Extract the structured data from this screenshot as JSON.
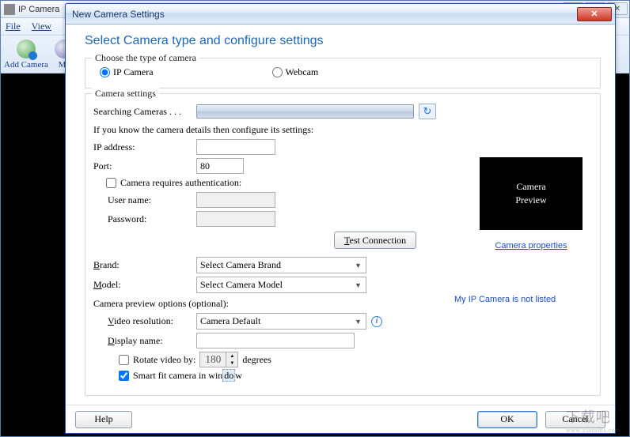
{
  "main": {
    "title": "IP Camera",
    "menu": {
      "file": "File",
      "view": "View"
    },
    "toolbar": {
      "addCamera": "Add Camera",
      "manage": "Ma"
    },
    "winbtn": {
      "min": "—",
      "max": "□",
      "close": "✕"
    }
  },
  "dialog": {
    "title": "New Camera Settings",
    "close_glyph": "✕",
    "heading": "Select Camera type and configure settings",
    "group_type_legend": "Choose the type of camera",
    "radio_ip": "IP Camera",
    "radio_webcam": "Webcam",
    "group_settings_legend": "Camera settings",
    "searching_label": "Searching Cameras . . .",
    "refresh_glyph": "↻",
    "know_details": "If you know the camera details then configure its settings:",
    "ip_label": "IP address:",
    "ip_value": "",
    "port_label": "Port:",
    "port_value": "80",
    "auth_label": "Camera requires authentication:",
    "user_label": "User name:",
    "user_value": "",
    "pass_label": "Password:",
    "pass_value": "",
    "test_btn": "Test Connection",
    "brand_label": "Brand:",
    "brand_value": "Select Camera Brand",
    "model_label": "Model:",
    "model_value": "Select Camera Model",
    "preview_opts": "Camera preview options (optional):",
    "vres_label": "Video resolution:",
    "vres_value": "Camera Default",
    "dname_label": "Display name:",
    "dname_value": "",
    "rotate_label_pre": "Rotate video by:",
    "rotate_value": "180",
    "rotate_label_post": "degrees",
    "smartfit_label_pre": "Smart fit camera in win",
    "smartfit_label_post": "w",
    "preview_text": "Camera\nPreview",
    "cam_props_link": "Camera properties",
    "not_listed_link": "My IP Camera is not listed",
    "info_glyph": "i",
    "footer": {
      "help": "Help",
      "ok": "OK",
      "cancel": "Cancel"
    }
  },
  "watermark": {
    "big": "下载吧",
    "small": "www.xiazaiba.com"
  }
}
